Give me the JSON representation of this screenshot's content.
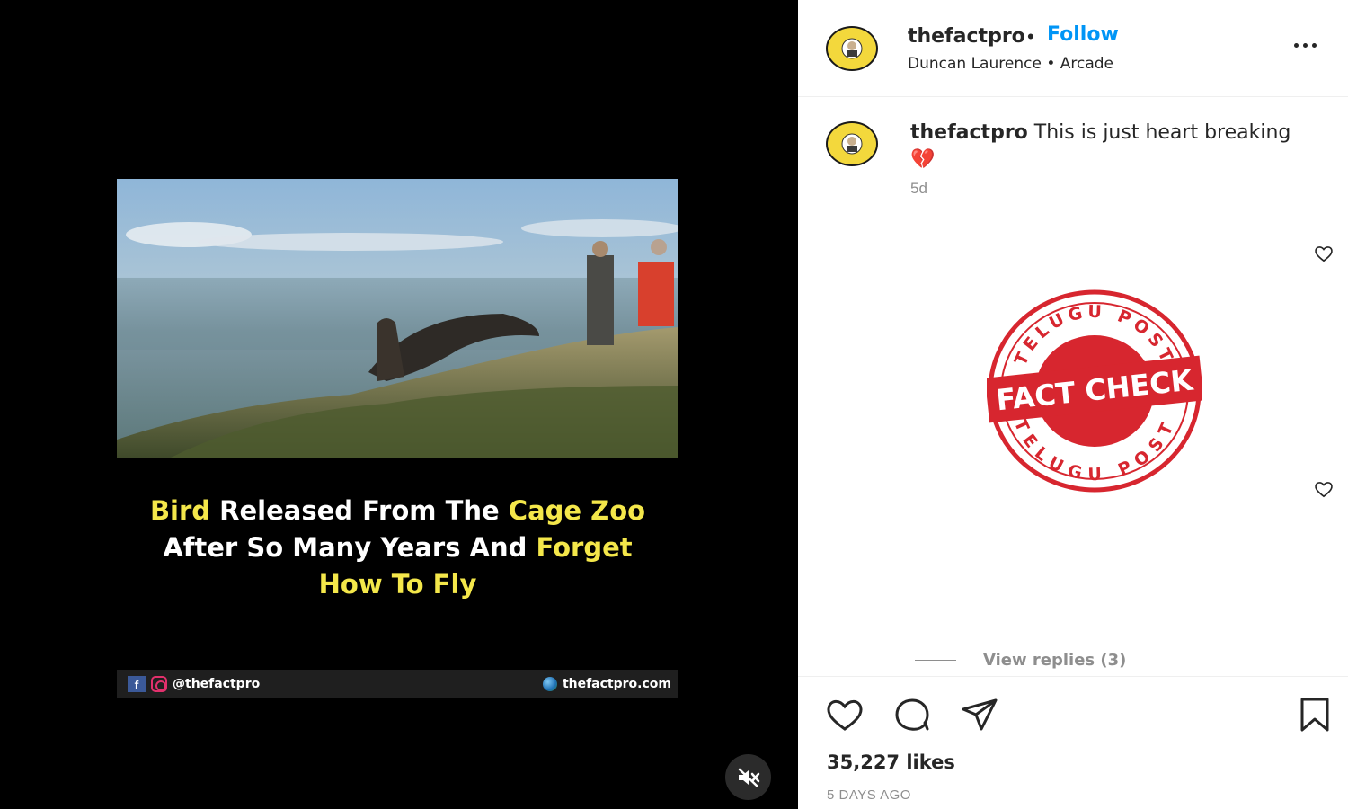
{
  "video": {
    "caption": [
      {
        "text": "Bird",
        "highlight": true
      },
      {
        "text": " Released From The ",
        "highlight": false
      },
      {
        "text": "Cage Zoo",
        "highlight": true
      },
      {
        "text": " After So Many Years And ",
        "highlight": false
      },
      {
        "text": "Forget",
        "highlight": true
      },
      {
        "text": " How To Fly",
        "highlight": true
      }
    ],
    "watermark_handle": "@thefactpro",
    "watermark_site": "thefactpro.com",
    "highlight_color": "#f4e74a"
  },
  "post": {
    "username": "thefactpro",
    "separator": "•",
    "follow_label": "Follow",
    "audio_artist": "Duncan Laurence",
    "audio_sep": "•",
    "audio_track": "Arcade",
    "avatar_text": "DID YOU KNOW FACTPRO"
  },
  "comment": {
    "username": "thefactpro",
    "text": "This is just heart breaking",
    "emoji": "💔",
    "time": "5d"
  },
  "stamp": {
    "top_text": "TELUGU POST",
    "center_text": "FACT CHECK",
    "bottom_text": "TELUGU POST",
    "color": "#d7262f"
  },
  "replies": {
    "label": "View replies (3)"
  },
  "stats": {
    "likes": "35,227 likes",
    "date": "5 DAYS AGO"
  },
  "colors": {
    "accent": "#0095f6",
    "text": "#262626",
    "muted": "#8e8e8e"
  }
}
